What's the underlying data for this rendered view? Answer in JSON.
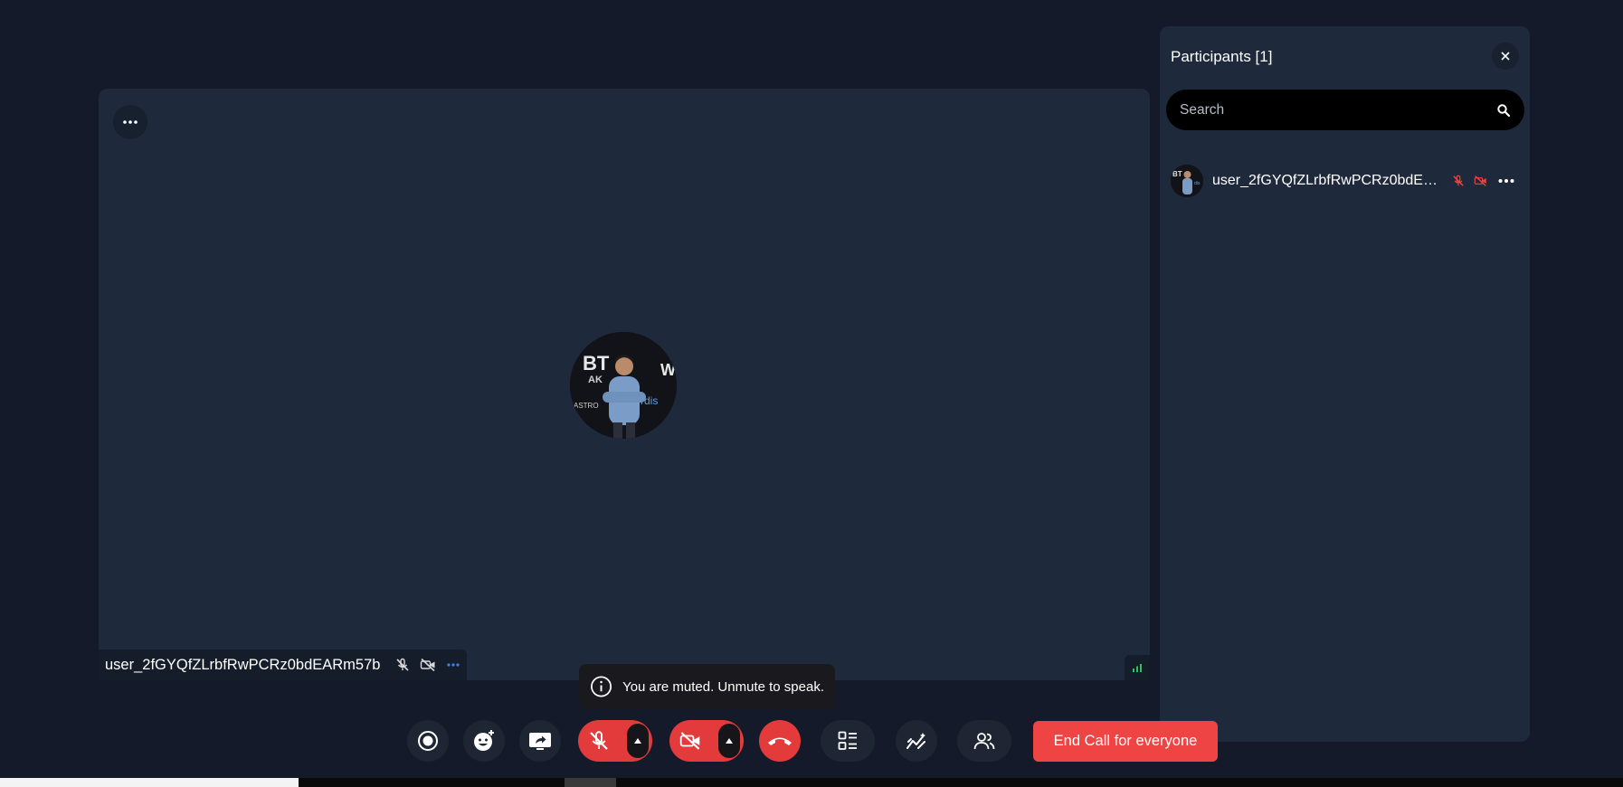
{
  "stage": {
    "participant_name": "user_2fGYQfZLrbfRwPCRz0bdEARm57b"
  },
  "panel": {
    "title": "Participants [1]",
    "search_placeholder": "Search",
    "participants": [
      {
        "name": "user_2fGYQfZLrbfRwPCRz0bdEA..."
      }
    ]
  },
  "toast": {
    "message": "You are muted. Unmute to speak."
  },
  "controls": {
    "end_call_all_label": "End Call for everyone",
    "icons": [
      "record-icon",
      "reaction-icon",
      "screen-share-icon",
      "mic-off-icon",
      "camera-off-icon",
      "hang-up-icon",
      "layout-icon",
      "whiteboard-icon",
      "participants-icon"
    ]
  },
  "colors": {
    "background": "#141a2a",
    "stage": "#1e293b",
    "danger": "#e33b3b",
    "end_call": "#ef4444",
    "signal": "#22c55e",
    "more_dots_blue": "#3b82f6"
  }
}
